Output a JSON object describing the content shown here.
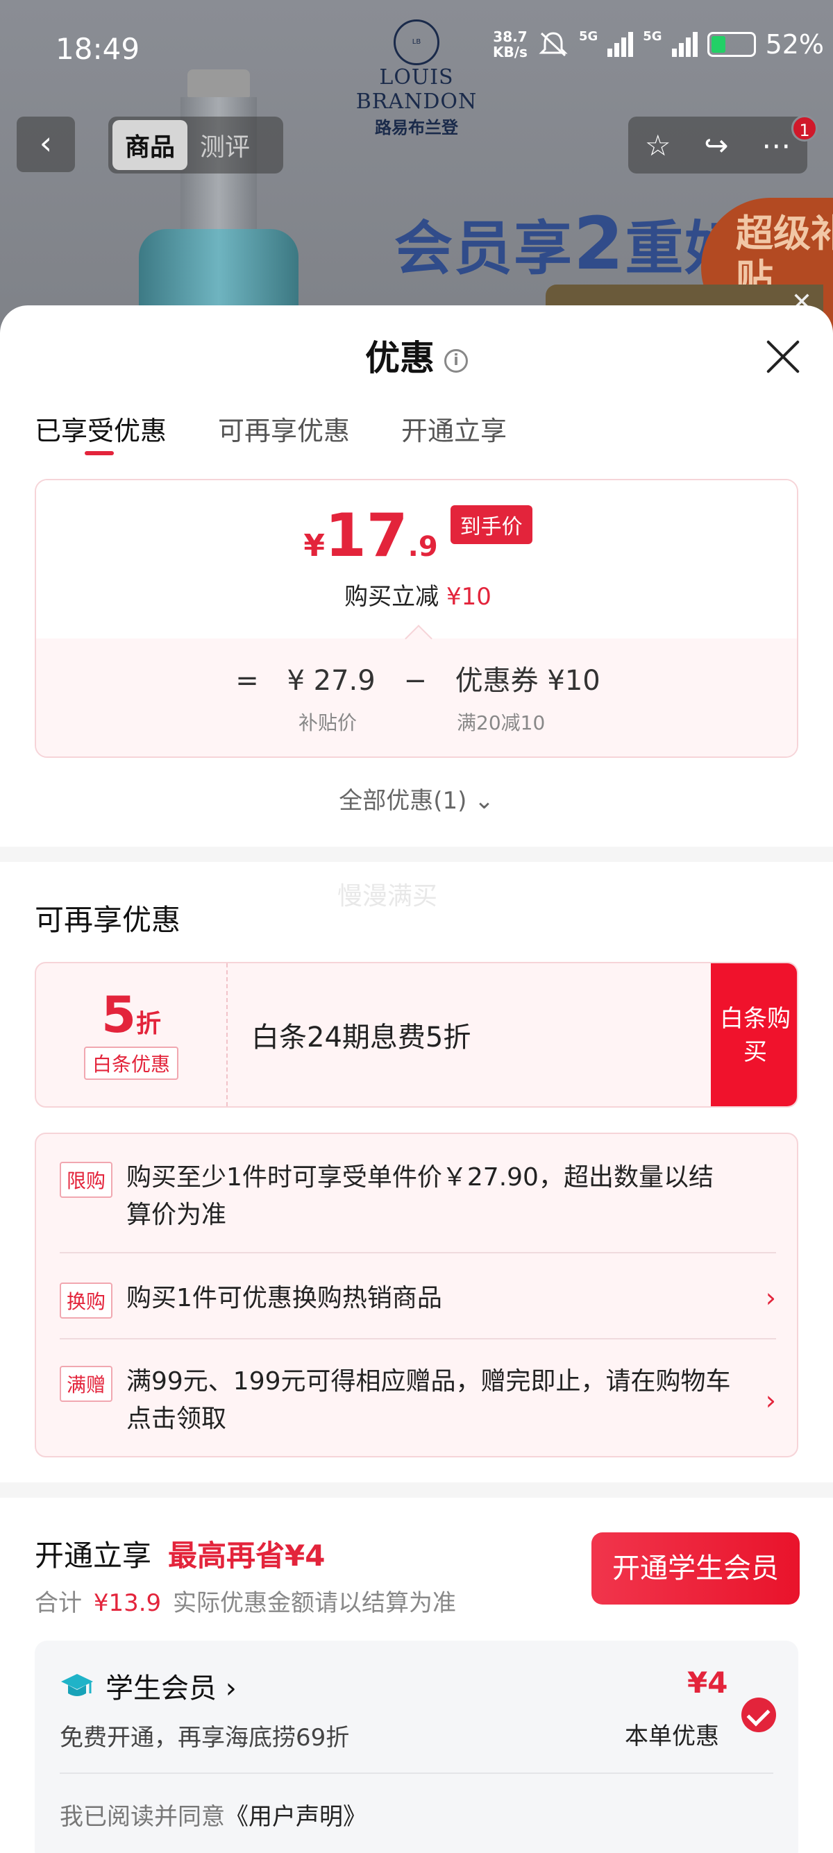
{
  "status_bar": {
    "time": "18:49",
    "speed_value": "38.7",
    "speed_unit": "KB/s",
    "net1": "5G",
    "net2": "5G",
    "battery": "52%"
  },
  "background": {
    "brand_logo": "LOUIS BRANDON",
    "brand_logo_cn": "路易布兰登",
    "nav_tabs": [
      "商品",
      "测评"
    ],
    "badge_count": "1",
    "banner_text_a": "会员享",
    "banner_text_b": "2",
    "banner_text_c": "重好",
    "banner_super": "超级补贴"
  },
  "sheet": {
    "title": "优惠",
    "tabs": [
      "已享受优惠",
      "可再享优惠",
      "开通立享"
    ],
    "active_tab_index": 0
  },
  "price_card": {
    "currency": "¥",
    "price_int": "17",
    "price_dec": ".9",
    "tag": "到手价",
    "subtitle_prefix": "购买立减",
    "subtitle_amount": "¥10",
    "eq": "=",
    "subsidy_price": "¥ 27.9",
    "minus": "−",
    "coupon_text": "优惠券 ¥10",
    "subsidy_label": "补贴价",
    "coupon_label": "满20减10"
  },
  "all_deals": "全部优惠(1)",
  "watermark": "慢漫满买",
  "more_deals": {
    "title": "可再享优惠",
    "coupon": {
      "discount_num": "5",
      "discount_unit": "折",
      "tag": "白条优惠",
      "desc": "白条24期息费5折",
      "button": "白条购买"
    },
    "rules": [
      {
        "tag": "限购",
        "text": "购买至少1件时可享受单件价￥27.90，超出数量以结算价为准",
        "arrow": ""
      },
      {
        "tag": "换购",
        "text": "购买1件可优惠换购热销商品",
        "arrow": "›"
      },
      {
        "tag": "满赠",
        "text": "满99元、199元可得相应赠品，赠完即止，请在购物车点击领取",
        "arrow": "›"
      }
    ]
  },
  "open_now": {
    "title": "开通立享",
    "highlight": "最高再省¥4",
    "sub_prefix": "合计",
    "sub_amount": "¥13.9",
    "sub_suffix": "实际优惠金额请以结算为准",
    "button": "开通学生会员",
    "member": {
      "name": "学生会员 ›",
      "desc": "免费开通，再享海底捞69折",
      "save": "¥4",
      "save_label": "本单优惠",
      "agree_prefix": "我已阅读并同意",
      "agree_link": "《用户声明》"
    }
  }
}
